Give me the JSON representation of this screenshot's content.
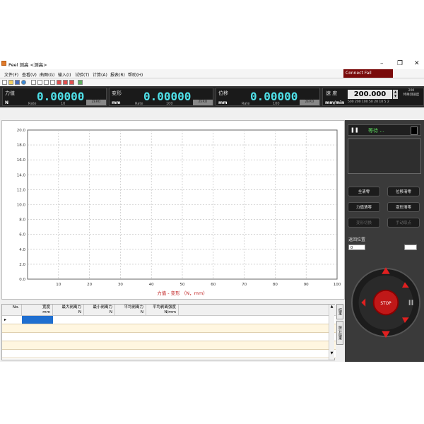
{
  "window": {
    "title": "Peel 测高 <测高>",
    "min": "–",
    "max": "❐",
    "close": "✕"
  },
  "menu": [
    "文件(F)",
    "查看(V)",
    "曲图(G)",
    "输入(I)",
    "试验(T)",
    "计算(A)",
    "报表(R)",
    "帮助(H)"
  ],
  "connect_status": "Connect Fail",
  "readouts": [
    {
      "label": "力值",
      "unit": "N",
      "value": "0.00000",
      "rate_label": "Rate",
      "rate": "10",
      "zero": "ZERO"
    },
    {
      "label": "变形",
      "unit": "mm",
      "value": "0.00000",
      "rate_label": "Rate",
      "rate": "100",
      "zero": "ZERO"
    },
    {
      "label": "位移",
      "unit": "mm",
      "value": "0.00000",
      "rate_label": "Rate",
      "rate": "100",
      "zero": "ZERO"
    }
  ],
  "speed": {
    "label": "速  度",
    "unit": "mm/min",
    "value": "200.000",
    "extra_value": "200",
    "extra_label": "特殊测速度",
    "presets": "500  200  100  50  20  10   5   2"
  },
  "chart_data": {
    "type": "line",
    "xlabel": "力值 - 变形  （N，mm）",
    "ylabel": "",
    "xlim": [
      0,
      100
    ],
    "ylim": [
      0,
      20
    ],
    "xticks": [
      "10",
      "20",
      "30",
      "40",
      "50",
      "60",
      "70",
      "80",
      "90",
      "100"
    ],
    "yticks": [
      "0.0",
      "2.0",
      "4.0",
      "6.0",
      "8.0",
      "10.0",
      "12.0",
      "14.0",
      "16.0",
      "18.0",
      "20.0"
    ],
    "series": [],
    "grid": true
  },
  "right": {
    "status": "等待 ...",
    "btns": [
      {
        "label": "全清零",
        "dim": false
      },
      {
        "label": "位移清零",
        "dim": false
      },
      {
        "label": "力值清零",
        "dim": false
      },
      {
        "label": "变形清零",
        "dim": false
      },
      {
        "label": "变形切换",
        "dim": true
      },
      {
        "label": "手动取点",
        "dim": true
      }
    ],
    "return_label": "返回位置",
    "return_value": "0",
    "return_label2": "",
    "stop_label": "STOP"
  },
  "table": {
    "headers": [
      {
        "name": "No.",
        "unit": ""
      },
      {
        "name": "宽度",
        "unit": "mm"
      },
      {
        "name": "最大剥离力",
        "unit": "N"
      },
      {
        "name": "最小剥离力",
        "unit": "N"
      },
      {
        "name": "平均剥离力",
        "unit": "N"
      },
      {
        "name": "平均剥离强度",
        "unit": "N/mm"
      }
    ],
    "row_marker": "▸",
    "side_tabs": [
      "结果",
      "统计结果"
    ]
  }
}
